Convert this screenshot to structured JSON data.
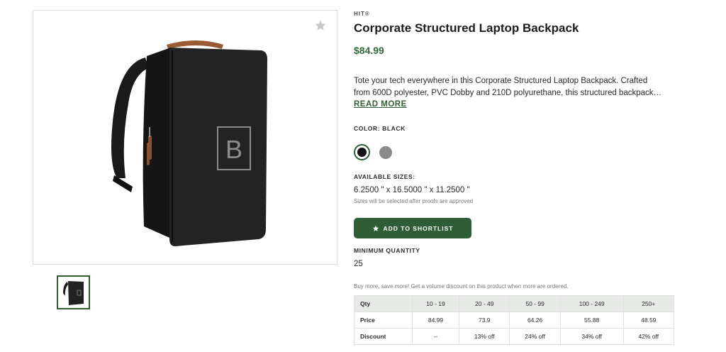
{
  "product": {
    "brand": "HIT®",
    "title": "Corporate Structured Laptop Backpack",
    "price": "$84.99",
    "description_line1": "Tote your tech everywhere in this Corporate Structured Laptop Backpack. Crafted",
    "description_line2": "from 600D polyester, PVC Dobby and 210D polyurethane, this structured backpack…",
    "read_more": "READ MORE"
  },
  "gallery": {
    "favorite_icon": "star-icon",
    "image_logo_letter": "B"
  },
  "color": {
    "label": "COLOR: BLACK",
    "swatches": [
      {
        "name": "black",
        "hex": "#111111",
        "selected": true
      },
      {
        "name": "gray",
        "hex": "#8b8b8b",
        "selected": false
      }
    ]
  },
  "sizes": {
    "label": "AVAILABLE SIZES:",
    "value": "6.2500 \" x 16.5000 \" x 11.2500 \"",
    "note": "Sizes will be selected after proofs are approved"
  },
  "shortlist_button": {
    "label": "ADD TO SHORTLIST",
    "icon": "star-icon"
  },
  "minimum_quantity": {
    "label": "MINIMUM QUANTITY",
    "value": "25"
  },
  "volume_note": "Buy more, save more! Get a volume discount on this product when more are ordered.",
  "pricing_table": {
    "header": [
      "Qty",
      "10 - 19",
      "20 - 49",
      "50 - 99",
      "100 - 249",
      "250+"
    ],
    "rows": [
      [
        "Price",
        "84.99",
        "73.9",
        "64.26",
        "55.88",
        "48.59"
      ],
      [
        "Discount",
        "--",
        "13% off",
        "24% off",
        "34% off",
        "42% off"
      ]
    ]
  },
  "colors": {
    "accent": "#2f5e36",
    "price": "#2f6a3a",
    "table_header_bg": "#e6e9e6"
  }
}
